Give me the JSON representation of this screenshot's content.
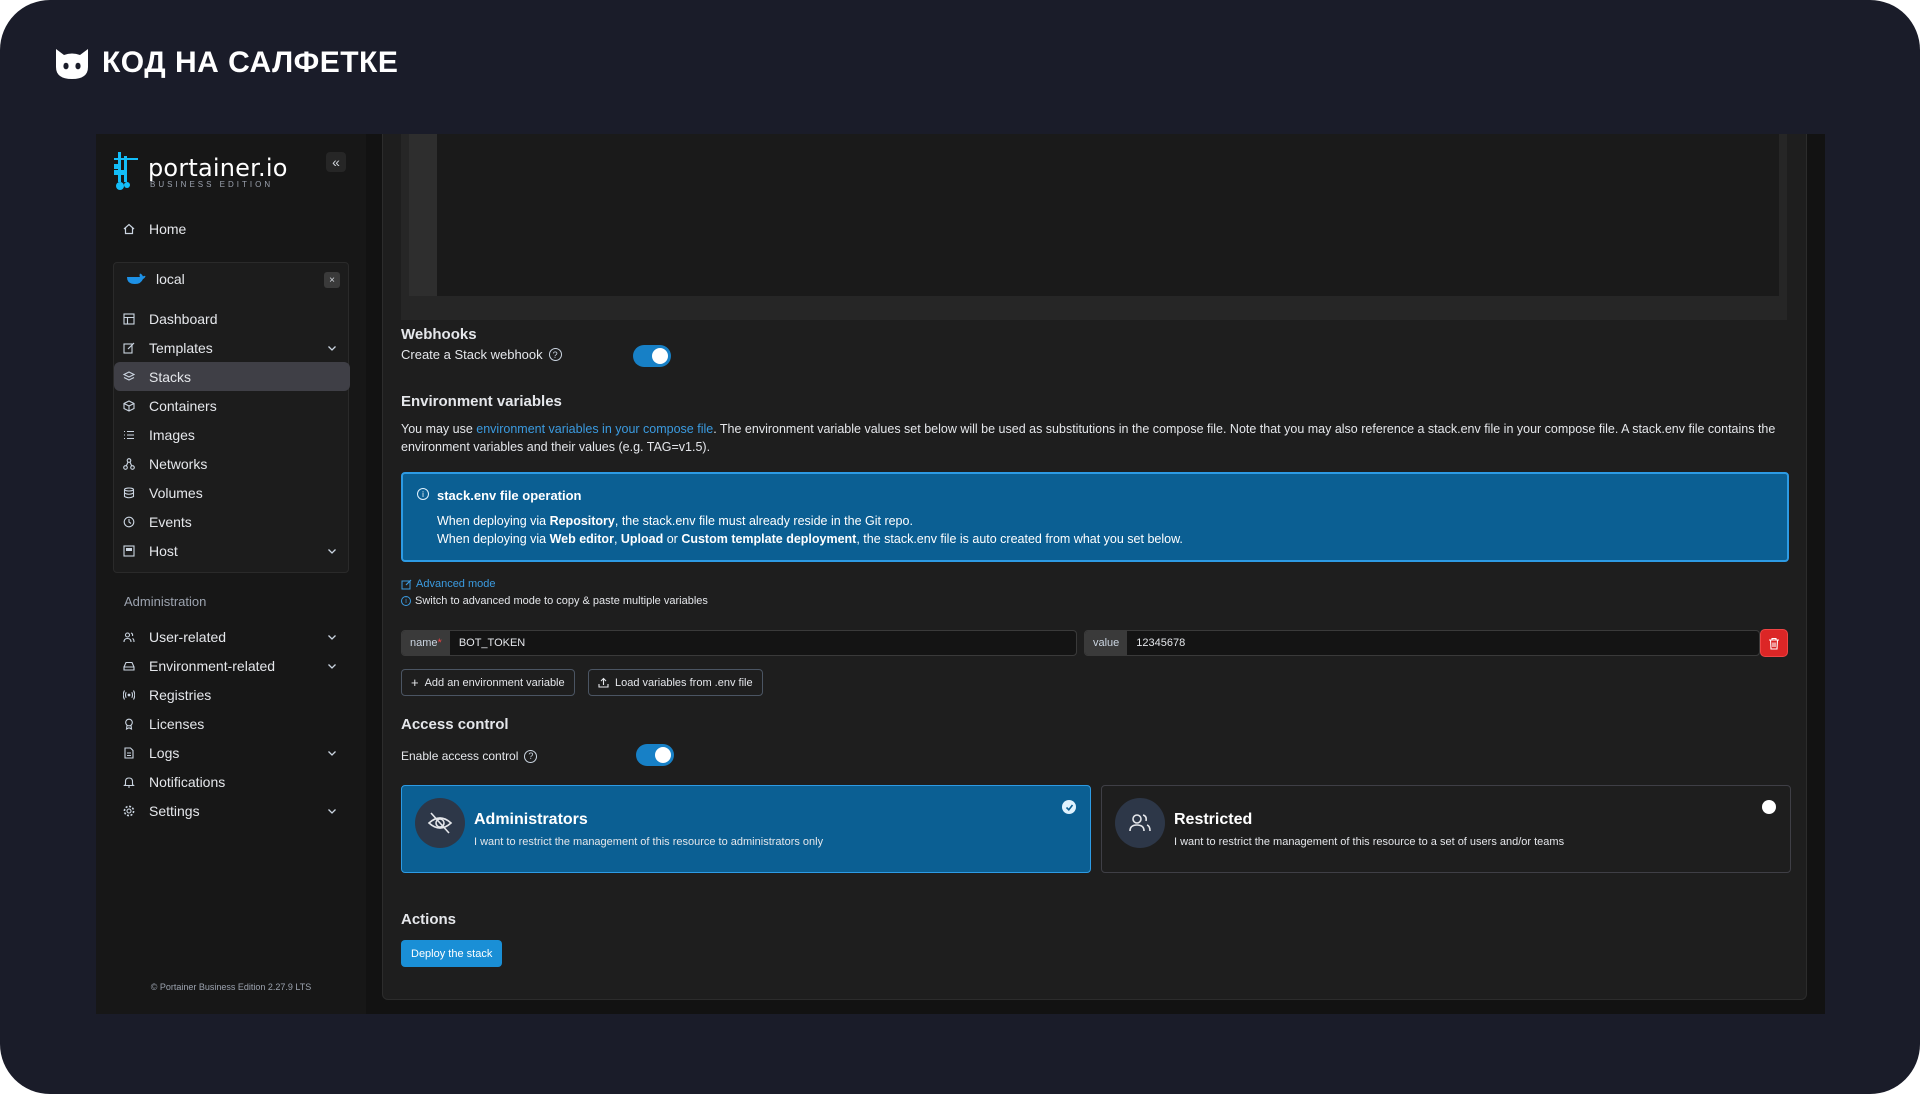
{
  "brand": {
    "text": "КОД НА САЛФЕТКЕ",
    "logo_icon": "cat-head-icon"
  },
  "sidebar": {
    "logo_name": "portainer.io",
    "logo_sub": "BUSINESS EDITION",
    "collapse_label": "«",
    "home": "Home",
    "environment": {
      "name": "local",
      "close": "×"
    },
    "env_items": [
      {
        "label": "Dashboard",
        "icon": "dashboard-icon"
      },
      {
        "label": "Templates",
        "icon": "edit-icon",
        "expandable": true
      },
      {
        "label": "Stacks",
        "icon": "layers-icon",
        "active": true
      },
      {
        "label": "Containers",
        "icon": "box-icon"
      },
      {
        "label": "Images",
        "icon": "list-icon"
      },
      {
        "label": "Networks",
        "icon": "network-icon"
      },
      {
        "label": "Volumes",
        "icon": "database-icon"
      },
      {
        "label": "Events",
        "icon": "clock-icon"
      },
      {
        "label": "Host",
        "icon": "host-icon",
        "expandable": true
      }
    ],
    "admin_label": "Administration",
    "admin_items": [
      {
        "label": "User-related",
        "icon": "users-icon",
        "expandable": true
      },
      {
        "label": "Environment-related",
        "icon": "hdd-icon",
        "expandable": true
      },
      {
        "label": "Registries",
        "icon": "radio-icon"
      },
      {
        "label": "Licenses",
        "icon": "award-icon"
      },
      {
        "label": "Logs",
        "icon": "file-icon",
        "expandable": true
      },
      {
        "label": "Notifications",
        "icon": "bell-icon"
      },
      {
        "label": "Settings",
        "icon": "settings-icon",
        "expandable": true
      }
    ],
    "footer": "© Portainer Business Edition 2.27.9 LTS"
  },
  "webhooks": {
    "title": "Webhooks",
    "label": "Create a Stack webhook",
    "enabled": true
  },
  "env_vars": {
    "title": "Environment variables",
    "desc_prefix": "You may use ",
    "desc_link": "environment variables in your compose file",
    "desc_suffix": ". The environment variable values set below will be used as substitutions in the compose file. Note that you may also reference a stack.env file in your compose file. A stack.env file contains the environment variables and their values (e.g. TAG=v1.5).",
    "info_title": "stack.env file operation",
    "info_l1_a": "When deploying via ",
    "info_l1_b": "Repository",
    "info_l1_c": ", the stack.env file must already reside in the Git repo.",
    "info_l2_a": "When deploying via ",
    "info_l2_b": "Web editor",
    "info_l2_c": ", ",
    "info_l2_d": "Upload",
    "info_l2_e": " or ",
    "info_l2_f": "Custom template deployment",
    "info_l2_g": ", the stack.env file is auto created from what you set below.",
    "advanced_link": "Advanced mode",
    "advanced_hint": "Switch to advanced mode to copy & paste multiple variables",
    "name_addon": "name",
    "name_required": "*",
    "name_value": "BOT_TOKEN",
    "value_addon": "value",
    "value_value": "12345678",
    "add_btn": "Add an environment variable",
    "load_btn": "Load variables from .env file"
  },
  "access": {
    "title": "Access control",
    "label": "Enable access control",
    "enabled": true,
    "admin_title": "Administrators",
    "admin_sub": "I want to restrict the management of this resource to administrators only",
    "admin_selected": true,
    "restricted_title": "Restricted",
    "restricted_sub": "I want to restrict the management of this resource to a set of users and/or teams"
  },
  "actions": {
    "title": "Actions",
    "deploy": "Deploy the stack"
  },
  "colors": {
    "frame": "#1a1c29",
    "accent": "#1a8fd6",
    "info_bg": "#0b5f93",
    "danger": "#dc2626"
  }
}
